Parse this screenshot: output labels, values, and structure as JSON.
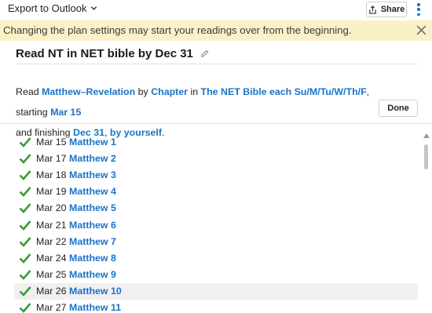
{
  "toolbar": {
    "export_label": "Export to Outlook",
    "share_label": "Share"
  },
  "banner": {
    "text": "Changing the plan settings may start your readings over from the beginning."
  },
  "plan": {
    "title": "Read NT in NET bible by Dec 31"
  },
  "settings": {
    "read": "Read ",
    "range": "Matthew–Revelation",
    "by": " by ",
    "unit": "Chapter",
    "in": " in ",
    "bible_schedule": "The NET Bible each Su/M/Tu/W/Th/F",
    "starting": ", starting ",
    "start_date": "Mar 15",
    "and_finishing": "and finishing ",
    "end_date": "Dec 31",
    "comma": ", ",
    "who": "by yourself",
    "period": ".",
    "done_label": "Done"
  },
  "readings": [
    {
      "date": "Mar 15",
      "passage": "Matthew 1"
    },
    {
      "date": "Mar 17",
      "passage": "Matthew 2"
    },
    {
      "date": "Mar 18",
      "passage": "Matthew 3"
    },
    {
      "date": "Mar 19",
      "passage": "Matthew 4"
    },
    {
      "date": "Mar 20",
      "passage": "Matthew 5"
    },
    {
      "date": "Mar 21",
      "passage": "Matthew 6"
    },
    {
      "date": "Mar 22",
      "passage": "Matthew 7"
    },
    {
      "date": "Mar 24",
      "passage": "Matthew 8"
    },
    {
      "date": "Mar 25",
      "passage": "Matthew 9"
    },
    {
      "date": "Mar 26",
      "passage": "Matthew 10"
    },
    {
      "date": "Mar 27",
      "passage": "Matthew 11"
    }
  ],
  "icons": {
    "export_chevron": "chevron-down-icon",
    "share": "share-icon",
    "menu": "kebab-menu-icon",
    "close": "close-icon",
    "edit": "pencil-icon",
    "completed": "checkmark-icon"
  },
  "colors": {
    "link": "#1a73c8",
    "banner_bg": "#fbf1c7",
    "check": "#3a9a3a",
    "row_highlight": "#f0f0f0"
  }
}
